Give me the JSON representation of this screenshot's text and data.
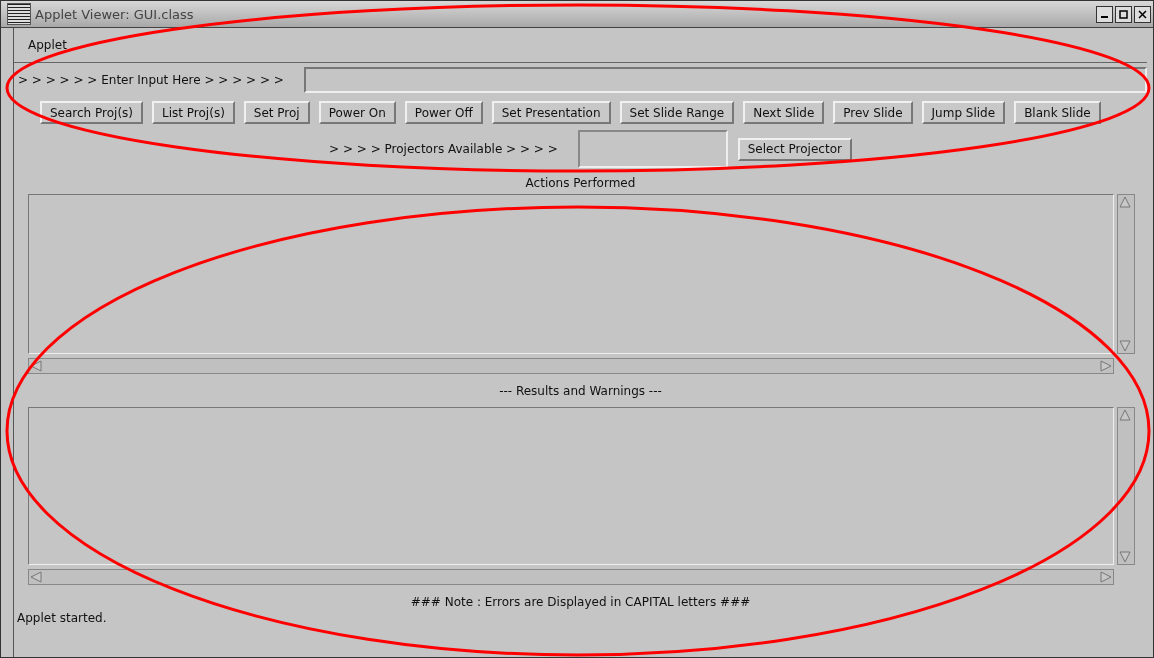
{
  "window": {
    "title": "Applet Viewer: GUI.class"
  },
  "menu": [
    "Applet"
  ],
  "input_row": {
    "label": "> > > > > > Enter Input Here > > > > > >"
  },
  "buttons": [
    "Search Proj(s)",
    "List Proj(s)",
    "Set Proj",
    "Power On",
    "Power Off",
    "Set Presentation",
    "Set Slide Range",
    "Next Slide",
    "Prev Slide",
    "Jump Slide",
    "Blank Slide"
  ],
  "projector_row": {
    "label": "> > > > Projectors Available > > > >",
    "select_button": "Select Projector"
  },
  "actions": {
    "label": "Actions Performed"
  },
  "results": {
    "label": "--- Results and Warnings ---"
  },
  "note": "### Note : Errors are Displayed in CAPITAL letters ###",
  "status_bar": "Applet started.",
  "annotations": [
    {
      "kind": "ellipse"
    },
    {
      "kind": "ellipse"
    }
  ]
}
